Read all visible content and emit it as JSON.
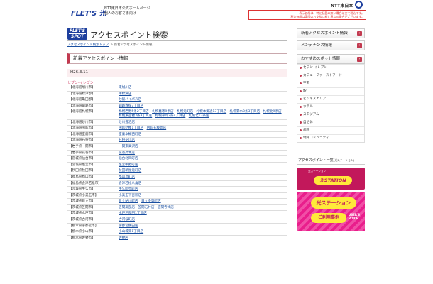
{
  "header": {
    "logo": "FLET'S 光",
    "ntt_line1": "NTT東日本公式ホームページ",
    "ntt_line2": "個人のお客さま向け",
    "notice_line1": "表示価格は、特に記載の無い場合は全て税込です。",
    "notice_line2": "税込価格は実際のお支払い額と異なる場合がございます。",
    "company": "NTT東日本"
  },
  "spot_logo": {
    "line1": "FLET'S",
    "line2": "SPOT"
  },
  "page_title": "アクセスポイント検索",
  "breadcrumb": {
    "home": "アクセスポイント検索トップ",
    "sep": "＞",
    "current": "新着アクセスポイント情報"
  },
  "section_title": "新着アクセスポイント情報",
  "date": "H26.3.11",
  "category": "セブン-イレブン",
  "rows": [
    {
      "pref": "【北海道旭川市】",
      "stores": [
        "東旭川店"
      ]
    },
    {
      "pref": "【北海道標津郡】",
      "stores": [
        "中標津店"
      ]
    },
    {
      "pref": "【北海道亀田郡】",
      "stores": [
        "七飯バイパス店"
      ]
    },
    {
      "pref": "【北海道釧路市】",
      "stores": [
        "釧路春採7丁目店"
      ]
    },
    {
      "pref": "【北海道札幌市】",
      "stores": [
        "札幌西野5条2丁目店",
        "札幌発寒9条店",
        "札幌元町店",
        "札幌本郷通13丁目店",
        "札幌菊水3条3丁目店",
        "札幌北9条店",
        "札幌東苗穂3条3丁目店",
        "札幌平岸2条4丁目店",
        "札幌北13条店"
      ]
    },
    {
      "pref": "【北海道砂川市】",
      "stores": [
        "砂川豊沼店"
      ]
    },
    {
      "pref": "【北海道函館市】",
      "stores": [
        "函館桔梗1丁目店",
        "函館五稜郭店"
      ]
    },
    {
      "pref": "【北海道室蘭市】",
      "stores": [
        "室蘭本輪西町店"
      ]
    },
    {
      "pref": "【北海道石狩市】",
      "stores": [
        "石狩花川店"
      ]
    },
    {
      "pref": "【岩手県一関市】",
      "stores": [
        "一関東高沢店"
      ]
    },
    {
      "pref": "【岩手県花巻市】",
      "stores": [
        "花巻高木店"
      ]
    },
    {
      "pref": "【宮城県仙台市】",
      "stores": [
        "仙台北目町店"
      ]
    },
    {
      "pref": "【宮城県塩釜市】",
      "stores": [
        "塩釜中野町店"
      ]
    },
    {
      "pref": "【秋田県秋田市】",
      "stores": [
        "秋田新屋元町店"
      ]
    },
    {
      "pref": "【福島県郡山市】",
      "stores": [
        "郡山島町店"
      ]
    },
    {
      "pref": "【福島県会津若松市】",
      "stores": [
        "会津若松八角店"
      ]
    },
    {
      "pref": "【茨城県牛久市】",
      "stores": [
        "牛久岡見町店"
      ]
    },
    {
      "pref": "【茨城県小美玉市】",
      "stores": [
        "小美玉下吉影店"
      ]
    },
    {
      "pref": "【茨城県日立市】",
      "stores": [
        "日立鮎川町店",
        "日立多賀町店"
      ]
    },
    {
      "pref": "【茨城県笠間市】",
      "stores": [
        "笠間友部店",
        "笠間石井店",
        "笠間寺崎店"
      ]
    },
    {
      "pref": "【茨城県水戸市】",
      "stores": [
        "水戸河和田1丁目店"
      ]
    },
    {
      "pref": "【茨城県古河市】",
      "stores": [
        "古河桜町店"
      ]
    },
    {
      "pref": "【栃木県宇都宮市】",
      "stores": [
        "宇都宮鶴田店"
      ]
    },
    {
      "pref": "【栃木県小山市】",
      "stores": [
        "小山城東1丁目店"
      ]
    },
    {
      "pref": "【栃木県佐野市】",
      "stores": [
        "佐野店"
      ]
    }
  ],
  "sidebar": {
    "btn_new": "新着アクセスポイント情報",
    "btn_maint": "メンテナンス情報",
    "btn_recommend": "おすすめスポット情報",
    "items": [
      "セブン-イレブン",
      "カフェ・ファーストフード",
      "空港",
      "駅",
      "ビジネスエリア",
      "ホテル",
      "スタジアム",
      "自治体",
      "病院",
      "地域コミュニティ"
    ],
    "list_title": "アクセスポイント一覧",
    "list_title_sub": "(光ステーション)",
    "banner1_top": "光ステーション",
    "banner1_main": "光STATION",
    "banner2_a": "光ステーション",
    "banner2_b": "ご利用事例",
    "banner2_c": "USER'S VOICE"
  },
  "colors": {
    "brand_blue": "#1d3f9e",
    "accent_red": "#c23a50",
    "banner_pink": "#e91e8c"
  }
}
